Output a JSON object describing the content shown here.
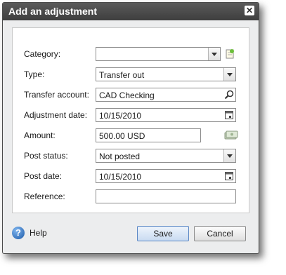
{
  "dialog": {
    "title": "Add an adjustment",
    "close_glyph": "✕"
  },
  "form": {
    "category": {
      "label": "Category:",
      "value": ""
    },
    "type": {
      "label": "Type:",
      "value": "Transfer out"
    },
    "transfer_account": {
      "label": "Transfer account:",
      "value": "CAD Checking"
    },
    "adjustment_date": {
      "label": "Adjustment date:",
      "value": "10/15/2010"
    },
    "amount": {
      "label": "Amount:",
      "value": "500.00 USD"
    },
    "post_status": {
      "label": "Post status:",
      "value": "Not posted"
    },
    "post_date": {
      "label": "Post date:",
      "value": "10/15/2010"
    },
    "reference": {
      "label": "Reference:",
      "value": ""
    }
  },
  "footer": {
    "help_label": "Help",
    "help_glyph": "?",
    "save_label": "Save",
    "cancel_label": "Cancel"
  },
  "colors": {
    "titlebar": "#4a4a4a",
    "dialog_bg": "#ecedee",
    "primary_button": "#c9dbf1",
    "help_icon": "#1c5aa8"
  },
  "icons": [
    "close-icon",
    "dropdown-arrow-icon",
    "add-category-icon",
    "search-icon",
    "calendar-icon",
    "currency-icon",
    "help-icon"
  ]
}
